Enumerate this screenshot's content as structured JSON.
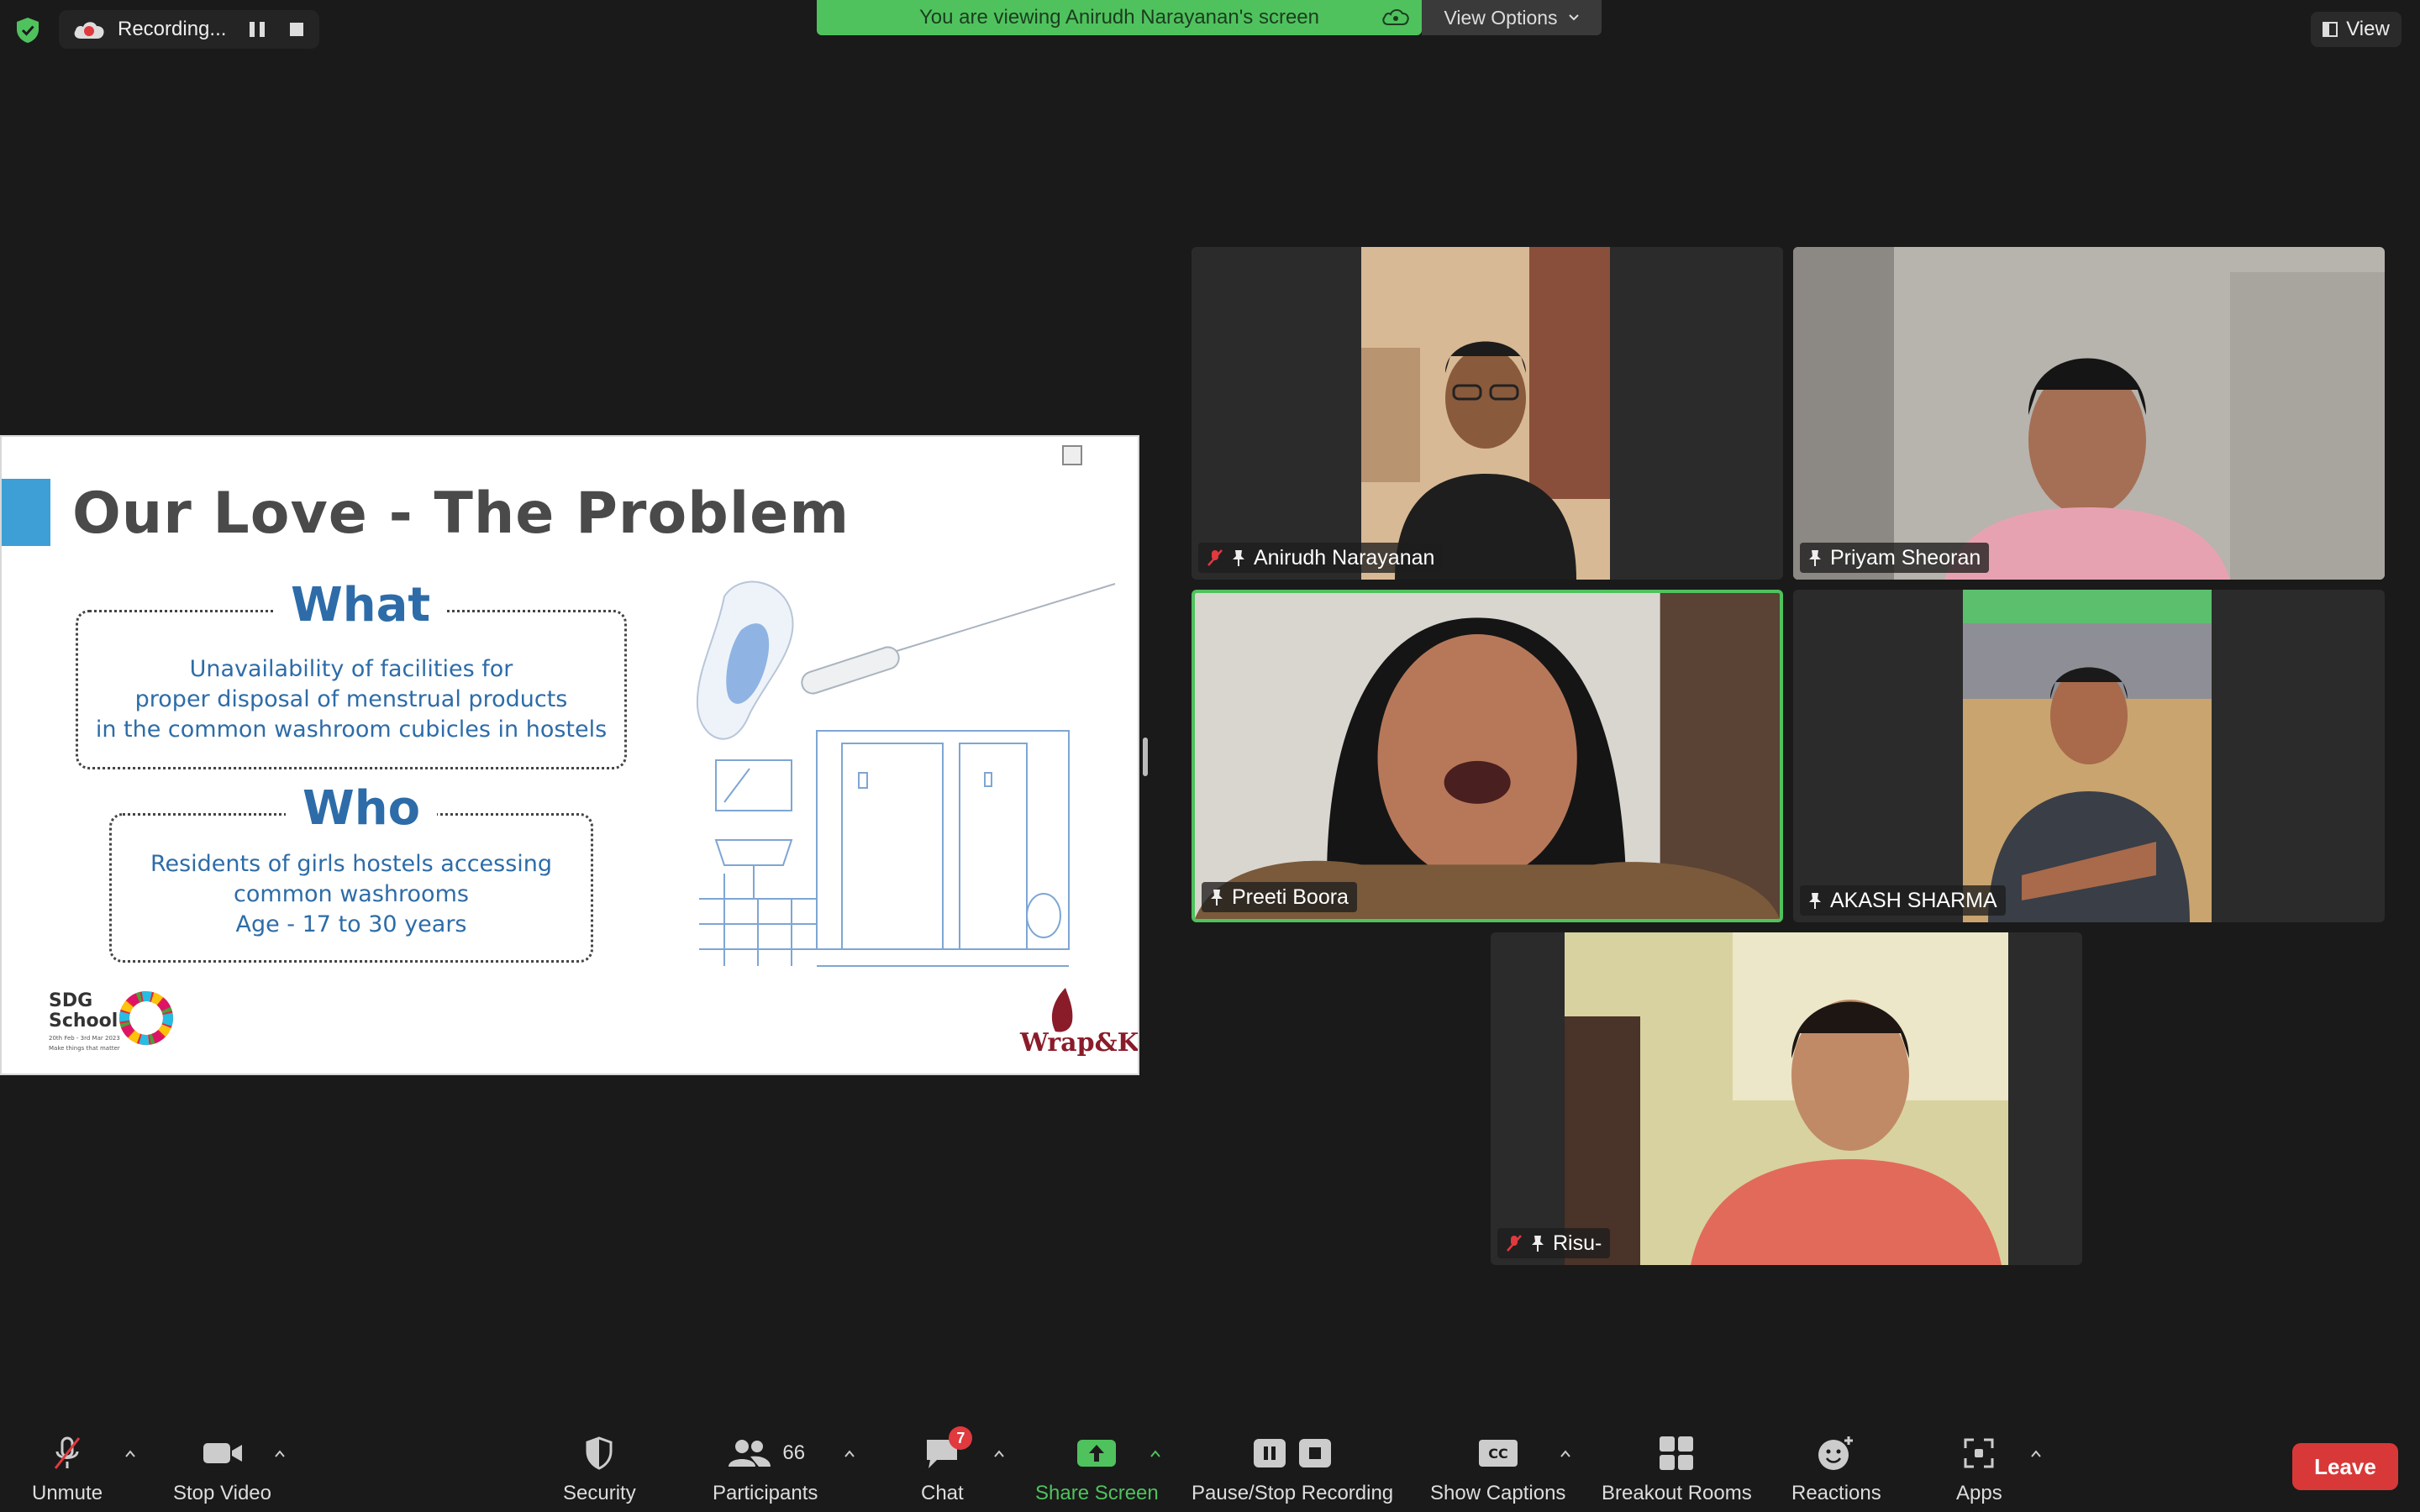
{
  "top_bar": {
    "recording_label": "Recording...",
    "viewing_banner": "You are viewing Anirudh Narayanan's screen",
    "view_options_label": "View Options",
    "view_label": "View"
  },
  "shared_slide": {
    "title": "Our Love - The Problem",
    "what_heading": "What",
    "what_lines": [
      "Unavailability of facilities for",
      "proper disposal of menstrual products",
      "in the common washroom cubicles in hostels"
    ],
    "who_heading": "Who",
    "who_lines": [
      "Residents of girls hostels accessing",
      "common washrooms",
      "Age - 17 to 30 years"
    ],
    "sdg_logo": {
      "line1": "SDG",
      "line2": "School",
      "subtitle": "20th Feb - 3rd Mar 2023",
      "tagline": "Make things that matter"
    },
    "brand_logo": "Wrap&Kin"
  },
  "participants": [
    {
      "name": "Anirudh Narayanan",
      "muted": true,
      "pinned": true,
      "active_speaker": false
    },
    {
      "name": "Priyam Sheoran",
      "muted": false,
      "pinned": true,
      "active_speaker": false
    },
    {
      "name": "Preeti Boora",
      "muted": false,
      "pinned": true,
      "active_speaker": true
    },
    {
      "name": "AKASH SHARMA",
      "muted": false,
      "pinned": true,
      "active_speaker": false
    },
    {
      "name": "Risu-",
      "muted": true,
      "pinned": true,
      "active_speaker": false
    }
  ],
  "toolbar": {
    "unmute": "Unmute",
    "stop_video": "Stop Video",
    "security": "Security",
    "participants": "Participants",
    "participant_count": "66",
    "chat": "Chat",
    "chat_badge": "7",
    "share_screen": "Share Screen",
    "pause_stop_recording": "Pause/Stop Recording",
    "show_captions": "Show Captions",
    "breakout_rooms": "Breakout Rooms",
    "reactions": "Reactions",
    "apps": "Apps",
    "leave": "Leave"
  },
  "colors": {
    "banner_green": "#4fc25d",
    "leave_red": "#d93838",
    "slide_blue": "#2d6ca8",
    "accent_blue": "#3e9fd6"
  }
}
